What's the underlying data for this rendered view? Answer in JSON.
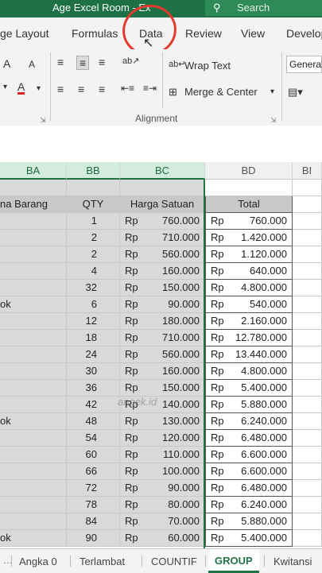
{
  "window": {
    "title": "Age Excel Room  -  Ex",
    "search_icon": "search-icon",
    "search_label": "Search"
  },
  "tabs": [
    {
      "label": "ge Layout"
    },
    {
      "label": "Formulas"
    },
    {
      "label": "Data"
    },
    {
      "label": "Review"
    },
    {
      "label": "View"
    },
    {
      "label": "Develop"
    }
  ],
  "ribbon": {
    "font_grow": "A",
    "font_shrink": "A",
    "font_color_icon": "A",
    "wrap_text": "Wrap Text",
    "merge_center": "Merge & Center",
    "number_format": "General",
    "alignment_label": "Alignment"
  },
  "columns": [
    {
      "label": "BA"
    },
    {
      "label": "BB"
    },
    {
      "label": "BC"
    },
    {
      "label": "BD"
    },
    {
      "label": "BI"
    }
  ],
  "table": {
    "headers": {
      "name": "na Barang",
      "qty": "QTY",
      "price": "Harga Satuan",
      "total": "Total"
    },
    "currency": "Rp",
    "rows": [
      {
        "name": "",
        "qty": "1",
        "price": "760.000",
        "total": "760.000"
      },
      {
        "name": "",
        "qty": "2",
        "price": "710.000",
        "total": "1.420.000"
      },
      {
        "name": "",
        "qty": "2",
        "price": "560.000",
        "total": "1.120.000"
      },
      {
        "name": "",
        "qty": "4",
        "price": "160.000",
        "total": "640.000"
      },
      {
        "name": "",
        "qty": "32",
        "price": "150.000",
        "total": "4.800.000"
      },
      {
        "name": "ok",
        "qty": "6",
        "price": "90.000",
        "total": "540.000"
      },
      {
        "name": "",
        "qty": "12",
        "price": "180.000",
        "total": "2.160.000"
      },
      {
        "name": "",
        "qty": "18",
        "price": "710.000",
        "total": "12.780.000"
      },
      {
        "name": "",
        "qty": "24",
        "price": "560.000",
        "total": "13.440.000"
      },
      {
        "name": "",
        "qty": "30",
        "price": "160.000",
        "total": "4.800.000"
      },
      {
        "name": "",
        "qty": "36",
        "price": "150.000",
        "total": "5.400.000"
      },
      {
        "name": "",
        "qty": "42",
        "price": "140.000",
        "total": "5.880.000"
      },
      {
        "name": "ok",
        "qty": "48",
        "price": "130.000",
        "total": "6.240.000"
      },
      {
        "name": "",
        "qty": "54",
        "price": "120.000",
        "total": "6.480.000"
      },
      {
        "name": "",
        "qty": "60",
        "price": "110.000",
        "total": "6.600.000"
      },
      {
        "name": "",
        "qty": "66",
        "price": "100.000",
        "total": "6.600.000"
      },
      {
        "name": "",
        "qty": "72",
        "price": "90.000",
        "total": "6.480.000"
      },
      {
        "name": "",
        "qty": "78",
        "price": "80.000",
        "total": "6.240.000"
      },
      {
        "name": "",
        "qty": "84",
        "price": "70.000",
        "total": "5.880.000"
      },
      {
        "name": "ok",
        "qty": "90",
        "price": "60.000",
        "total": "5.400.000"
      }
    ]
  },
  "watermark": "angek.id",
  "sheets": [
    {
      "label": "Angka 0"
    },
    {
      "label": "Terlambat"
    },
    {
      "label": "COUNTIF"
    },
    {
      "label": "GROUP"
    },
    {
      "label": "Kwitansi"
    }
  ],
  "accent_color": "#217346"
}
